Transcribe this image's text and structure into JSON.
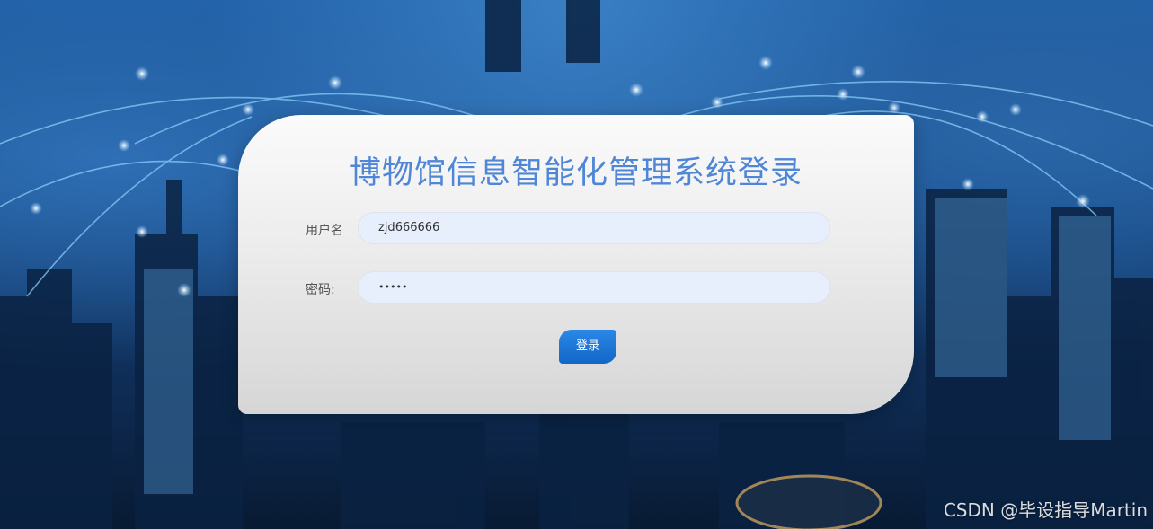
{
  "login": {
    "title": "博物馆信息智能化管理系统登录",
    "username_label": "用户名",
    "username_value": "zjd666666",
    "password_label": "密码:",
    "password_value": "•••••",
    "submit_label": "登录"
  },
  "watermark": "CSDN @毕设指导Martin",
  "colors": {
    "title": "#4f86d6",
    "field_bg": "#e8effc",
    "button": "#1a74d6"
  }
}
